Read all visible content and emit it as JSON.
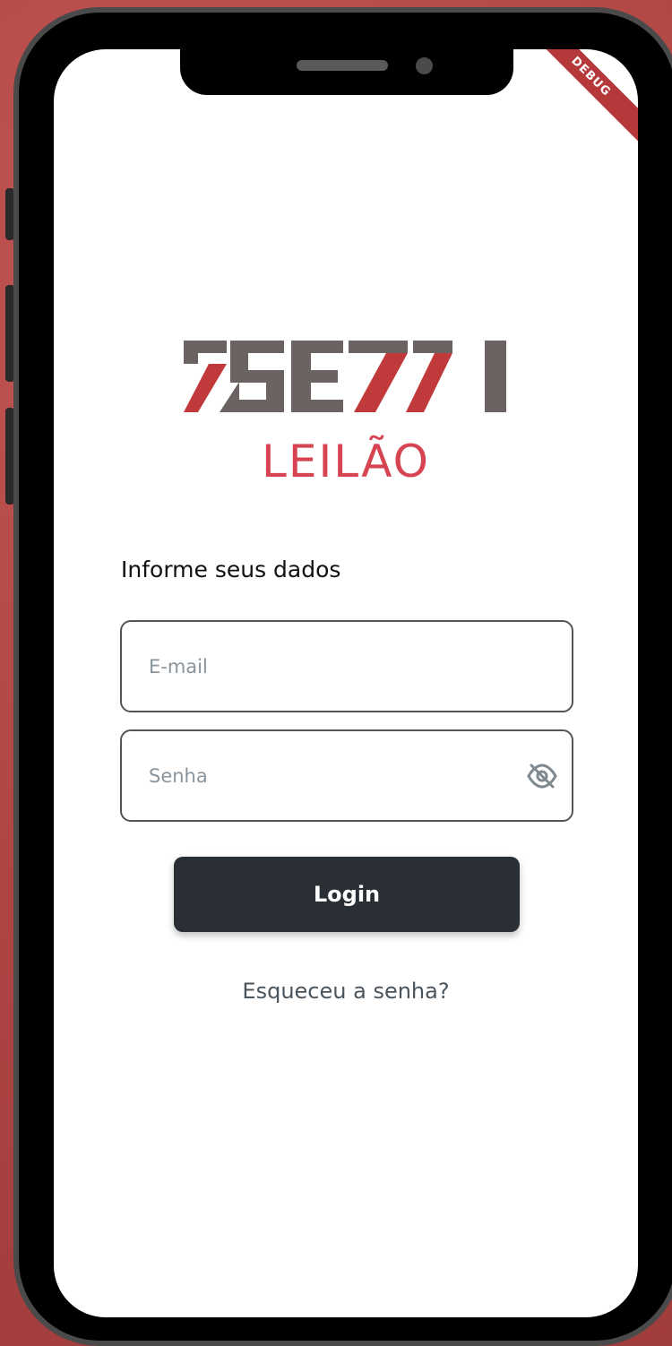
{
  "debug_banner": "DEBUG",
  "brand": {
    "logo_text": "7SE7I",
    "subtitle": "LEILÃO",
    "colors": {
      "red": "#c0393b",
      "gray": "#6b6362",
      "subtitle": "#d54450"
    }
  },
  "form": {
    "title": "Informe seus dados",
    "email_placeholder": "E-mail",
    "password_placeholder": "Senha",
    "password_toggle_icon": "eye-off-icon",
    "login_label": "Login",
    "forgot_label": "Esqueceu a senha?"
  }
}
